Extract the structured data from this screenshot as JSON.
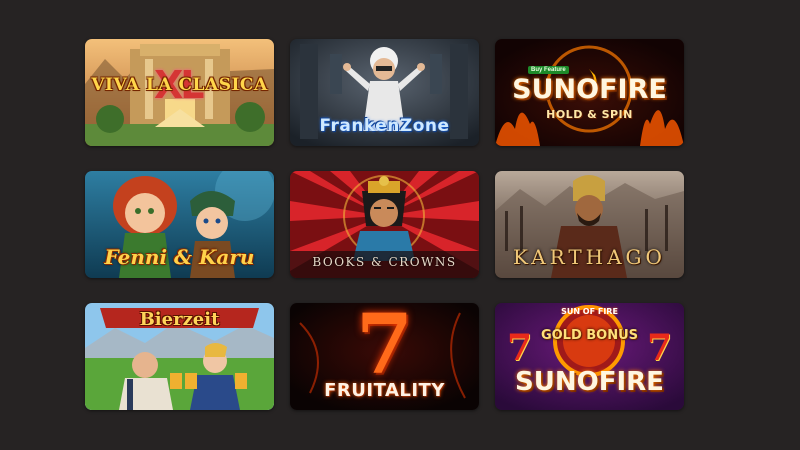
{
  "games": [
    {
      "title": "VIVA LA CLASICA",
      "mark": "XL"
    },
    {
      "title": "FrankenZone"
    },
    {
      "badge": "Buy Feature",
      "title": "SUNOFIRE",
      "subtitle": "HOLD & SPIN"
    },
    {
      "title": "Fenni & Karu"
    },
    {
      "title": "BOOKS & CROWNS"
    },
    {
      "title": "KARTHAGO"
    },
    {
      "title": "Bierzeit"
    },
    {
      "title": "FRUITALITY",
      "mark": "7"
    },
    {
      "top": "SUN OF FIRE",
      "middle": "GOLD BONUS",
      "title": "SUNOFIRE",
      "mark": "7"
    }
  ],
  "colors": {
    "page_background": "#262323",
    "accent_gold": "#ffd64a",
    "fire_orange": "#ff7a00"
  }
}
